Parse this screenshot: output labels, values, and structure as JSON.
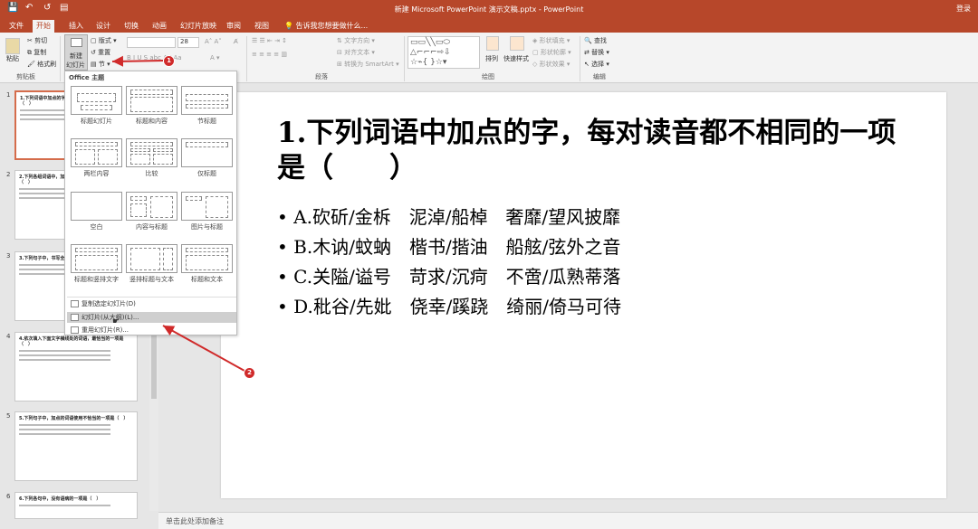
{
  "window": {
    "title": "新建 Microsoft PowerPoint 演示文稿.pptx - PowerPoint",
    "user": "登录"
  },
  "tabs": [
    "文件",
    "开始",
    "插入",
    "设计",
    "切换",
    "动画",
    "幻灯片放映",
    "审阅",
    "视图"
  ],
  "tell_me": "告诉我您想要做什么...",
  "ribbon": {
    "clipboard": {
      "paste": "粘贴",
      "cut": "剪切",
      "copy": "复制",
      "format_painter": "格式刷",
      "group": "剪贴板"
    },
    "slides": {
      "new_slide_line1": "新建",
      "new_slide_line2": "幻灯片",
      "layout": "版式",
      "reset": "重置",
      "section": "节"
    },
    "font": {
      "size": "28",
      "group": "字体"
    },
    "paragraph": {
      "text_direction": "文字方向",
      "align_text": "对齐文本",
      "smartart": "转换为 SmartArt",
      "group": "段落"
    },
    "drawing": {
      "arrange": "排列",
      "quick_styles": "快速样式",
      "shape_fill": "形状填充",
      "shape_outline": "形状轮廓",
      "shape_effects": "形状效果",
      "group": "绘图"
    },
    "editing": {
      "find": "查找",
      "replace": "替换",
      "select": "选择",
      "group": "编辑"
    }
  },
  "layout_menu": {
    "header": "Office 主题",
    "layouts": [
      "标题幻灯片",
      "标题和内容",
      "节标题",
      "两栏内容",
      "比较",
      "仅标题",
      "空白",
      "内容与标题",
      "图片与标题",
      "标题和竖排文字",
      "竖排标题与文本",
      "标题和文本"
    ],
    "items": [
      "复制选定幻灯片(D)",
      "幻灯片(从大纲)(L)...",
      "重用幻灯片(R)..."
    ]
  },
  "thumbnails": [
    {
      "num": "1",
      "title": "1.下列词语中加点的字，每对读音都不相同的一项是（　）"
    },
    {
      "num": "2",
      "title": "2.下列各组词语中，加点的字读音全都正确的一项是（　）"
    },
    {
      "num": "3",
      "title": "3.下列句子中，书写全都正确的一项是（　）"
    },
    {
      "num": "4",
      "title": "4.依次填入下面文字横线处的词语，最恰当的一项是（　）"
    },
    {
      "num": "5",
      "title": "5.下列句子中，加点的词语使用不恰当的一项是（　）"
    },
    {
      "num": "6",
      "title": "6.下列各句中，没有语病的一项是（　）"
    }
  ],
  "slide": {
    "title": "1.下列词语中加点的字，每对读音都不相同的一项是（　　）",
    "bullets": [
      "• A.砍斫/金柝　泥淖/船棹　奢靡/望风披靡",
      "• B.木讷/蚊蚋　楷书/揩油　船舷/弦外之音",
      "• C.关隘/谥号　苛求/沉疴　不啻/瓜熟蒂落",
      "• D.秕谷/先妣　侥幸/蹊跷　绮丽/倚马可待"
    ]
  },
  "notes": "单击此处添加备注",
  "callouts": [
    "1",
    "2"
  ],
  "colors": {
    "accent": "#b7472a",
    "callout": "#d02a2a"
  }
}
